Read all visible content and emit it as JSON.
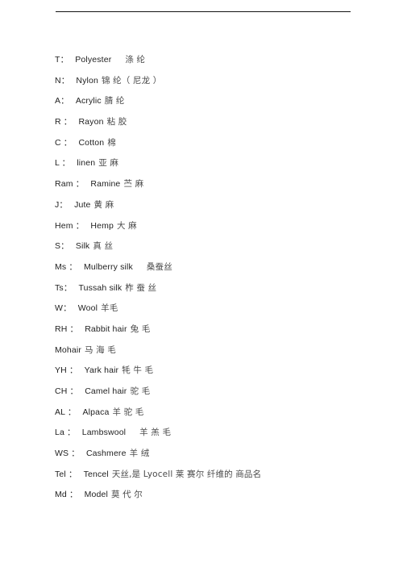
{
  "document": {
    "title": "Textile Fiber Abbreviations List",
    "rule": {
      "name": "top-horizontal-rule",
      "color": "#141414"
    },
    "text_color": "#2b2b2b",
    "background_color": "#ffffff"
  },
  "entries": [
    {
      "abbr": "T",
      "colon": "：",
      "english": "Polyester",
      "chinese": "涤 纶",
      "gap": "lg"
    },
    {
      "abbr": "N",
      "colon": "：",
      "english": "Nylon",
      "chinese": "锦 纶（ 尼龙 ）",
      "gap": "sm"
    },
    {
      "abbr": "A",
      "colon": "：",
      "english": "Acrylic",
      "chinese": "腈 纶",
      "gap": "sm"
    },
    {
      "abbr": "R",
      "colon": " ：",
      "english": "Rayon",
      "chinese": "粘 胶",
      "gap": "sm"
    },
    {
      "abbr": "C",
      "colon": " ：",
      "english": "Cotton",
      "chinese": "棉",
      "gap": "sm"
    },
    {
      "abbr": "L",
      "colon": " ：",
      "english": "linen",
      "chinese": "亚 麻",
      "gap": "sm"
    },
    {
      "abbr": "Ram",
      "colon": " ：",
      "english": "Ramine",
      "chinese": "苎 麻",
      "gap": "sm"
    },
    {
      "abbr": "J",
      "colon": "：",
      "english": "Jute",
      "chinese": "黄 麻",
      "gap": "sm"
    },
    {
      "abbr": "Hem",
      "colon": " ：",
      "english": "Hemp",
      "chinese": "大 麻",
      "gap": "sm"
    },
    {
      "abbr": "S",
      "colon": "：",
      "english": "Silk",
      "chinese": "真 丝",
      "gap": "sm"
    },
    {
      "abbr": "Ms",
      "colon": " ：",
      "english": "Mulberry silk",
      "chinese": "桑蚕丝",
      "gap": "lg"
    },
    {
      "abbr": "Ts",
      "colon": "：",
      "english": "Tussah silk",
      "chinese": "柞 蚕 丝",
      "gap": "sm"
    },
    {
      "abbr": "W",
      "colon": "：",
      "english": "Wool",
      "chinese": "羊毛",
      "gap": "sm"
    },
    {
      "abbr": "RH",
      "colon": " ：",
      "english": "Rabbit hair",
      "chinese": "兔 毛",
      "gap": "sm"
    },
    {
      "abbr": "Mohair",
      "colon": "",
      "english": "",
      "chinese": "马 海 毛",
      "gap": "sm"
    },
    {
      "abbr": "YH",
      "colon": " ：",
      "english": "Yark hair",
      "chinese": "牦 牛 毛",
      "gap": "sm"
    },
    {
      "abbr": "CH",
      "colon": " ：",
      "english": "Camel hair",
      "chinese": "驼 毛",
      "gap": "sm"
    },
    {
      "abbr": "AL",
      "colon": " ：",
      "english": "Alpaca",
      "chinese": "羊 驼 毛",
      "gap": "sm"
    },
    {
      "abbr": "La",
      "colon": " ：",
      "english": "Lambswool",
      "chinese": "羊 羔 毛",
      "gap": "lg"
    },
    {
      "abbr": "WS",
      "colon": " ：",
      "english": "Cashmere",
      "chinese": "羊 绒",
      "gap": "sm"
    },
    {
      "abbr": "Tel",
      "colon": " ：",
      "english": "Tencel",
      "chinese": "天丝,是 Lyocell 莱 赛尔 纤维的 商品名",
      "gap": "sm"
    },
    {
      "abbr": "Md",
      "colon": " ：",
      "english": "Model",
      "chinese": "莫 代 尔",
      "gap": "sm"
    }
  ]
}
